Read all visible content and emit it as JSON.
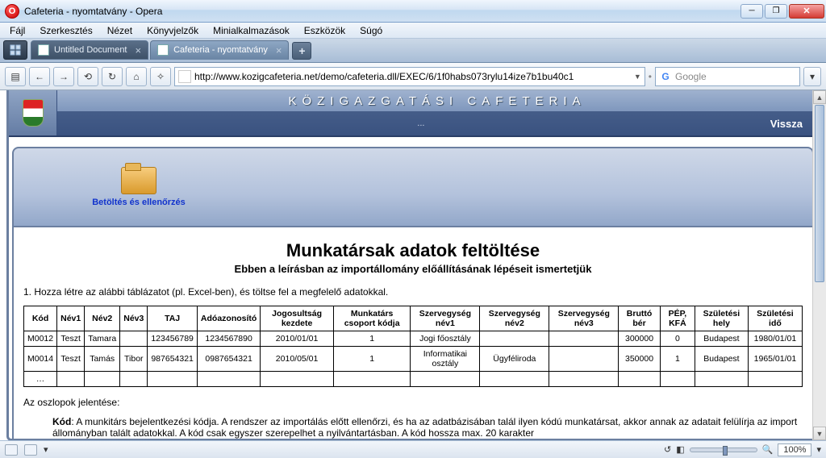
{
  "window": {
    "title": "Cafeteria - nyomtatvány - Opera"
  },
  "menu": [
    "Fájl",
    "Szerkesztés",
    "Nézet",
    "Könyvjelzők",
    "Minialkalmazások",
    "Eszközök",
    "Súgó"
  ],
  "tabs": [
    {
      "label": "Untitled Document",
      "active": false
    },
    {
      "label": "Cafeteria - nyomtatvány",
      "active": true
    }
  ],
  "nav": {
    "url": "http://www.kozigcafeteria.net/demo/cafeteria.dll/EXEC/6/1f0habs073rylu14ize7b1bu40c1",
    "search_placeholder": "Google"
  },
  "app": {
    "banner_title": "KÖZIGAZGATÁSI CAFETERIA",
    "banner_sub": "...",
    "back_label": "Vissza",
    "tool_label": "Betöltés és ellenőrzés",
    "doc_title": "Munkatársak adatok feltöltése",
    "doc_subtitle": "Ebben a leírásban az importállomány előállításának lépéseit ismertetjük",
    "step1": "1. Hozza létre az alábbi táblázatot (pl. Excel-ben), és töltse fel a megfelelő adatokkal.",
    "headers": [
      "Kód",
      "Név1",
      "Név2",
      "Név3",
      "TAJ",
      "Adóazonosító",
      "Jogosultság kezdete",
      "Munkatárs csoport kódja",
      "Szervegység név1",
      "Szervegység név2",
      "Szervegység név3",
      "Bruttó bér",
      "PÉP, KFÁ",
      "Születési hely",
      "Születési idő"
    ],
    "rows": [
      [
        "M0012",
        "Teszt",
        "Tamara",
        "",
        "123456789",
        "1234567890",
        "2010/01/01",
        "1",
        "Jogi főosztály",
        "",
        "",
        "300000",
        "0",
        "Budapest",
        "1980/01/01"
      ],
      [
        "M0014",
        "Teszt",
        "Tamás",
        "Tibor",
        "987654321",
        "0987654321",
        "2010/05/01",
        "1",
        "Informatikai osztály",
        "Ügyféliroda",
        "",
        "350000",
        "1",
        "Budapest",
        "1965/01/01"
      ],
      [
        "…",
        "",
        "",
        "",
        "",
        "",
        "",
        "",
        "",
        "",
        "",
        "",
        "",
        "",
        ""
      ]
    ],
    "cols_label": "Az oszlopok jelentése:",
    "col_kod_name": "Kód",
    "col_kod_desc": ": A munkitárs bejelentkezési kódja. A rendszer az importálás előtt ellenőrzi, és ha az adatbázisában talál ilyen kódú munkatársat, akkor annak az adatait felülírja az import állományban talált adatokkal. A kód csak egyszer szerepelhet a nyilvántartásban. A kód hossza max. 20 karakter"
  },
  "status": {
    "zoom": "100%"
  }
}
